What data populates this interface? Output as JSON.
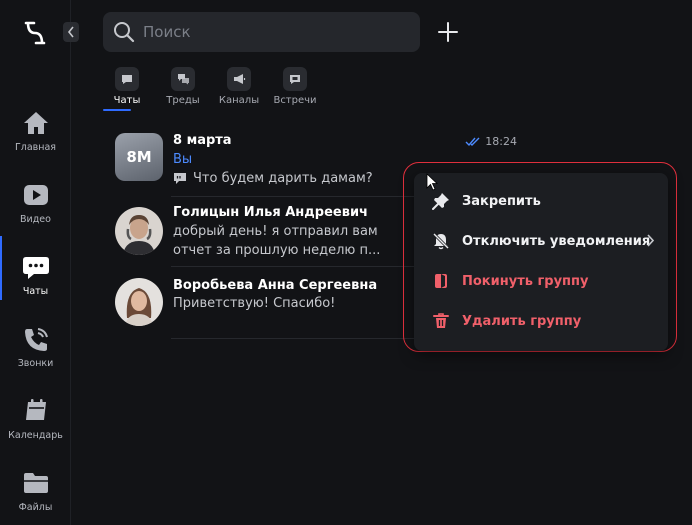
{
  "nav": {
    "items": [
      {
        "id": "home",
        "label": "Главная",
        "icon": "home-icon"
      },
      {
        "id": "video",
        "label": "Видео",
        "icon": "video-icon"
      },
      {
        "id": "chats",
        "label": "Чаты",
        "icon": "chat-icon",
        "active": true
      },
      {
        "id": "calls",
        "label": "Звонки",
        "icon": "phone-icon"
      },
      {
        "id": "calendar",
        "label": "Календарь",
        "icon": "calendar-icon"
      },
      {
        "id": "files",
        "label": "Файлы",
        "icon": "folder-icon"
      }
    ]
  },
  "search": {
    "placeholder": "Поиск"
  },
  "tabs": [
    {
      "label": "Чаты",
      "active": true
    },
    {
      "label": "Треды"
    },
    {
      "label": "Каналы"
    },
    {
      "label": "Встречи"
    }
  ],
  "chats": [
    {
      "name": "8 марта",
      "avatar_text": "8М",
      "line1": "Вы",
      "line2": "Что будем дарить дамам?",
      "time": "18:24"
    },
    {
      "name": "Голицын Илья Андреевич",
      "line1": "добрый день! я отправил вам",
      "line2": "отчет за прошлую неделю п..."
    },
    {
      "name": "Воробьева Анна Сергеевна",
      "line1": "Приветствую! Спасибо!"
    }
  ],
  "context_menu": {
    "items": [
      {
        "label": "Закрепить",
        "icon": "pin-icon"
      },
      {
        "label": "Отключить уведомления",
        "icon": "bell-off-icon",
        "submenu": true
      },
      {
        "label": "Покинуть группу",
        "icon": "leave-icon",
        "danger": true
      },
      {
        "label": "Удалить группу",
        "icon": "trash-icon",
        "danger": true
      }
    ]
  },
  "colors": {
    "accent": "#2f6bff",
    "danger": "#f0606a",
    "highlight": "#e0303d",
    "read_check": "#4d8bff"
  }
}
